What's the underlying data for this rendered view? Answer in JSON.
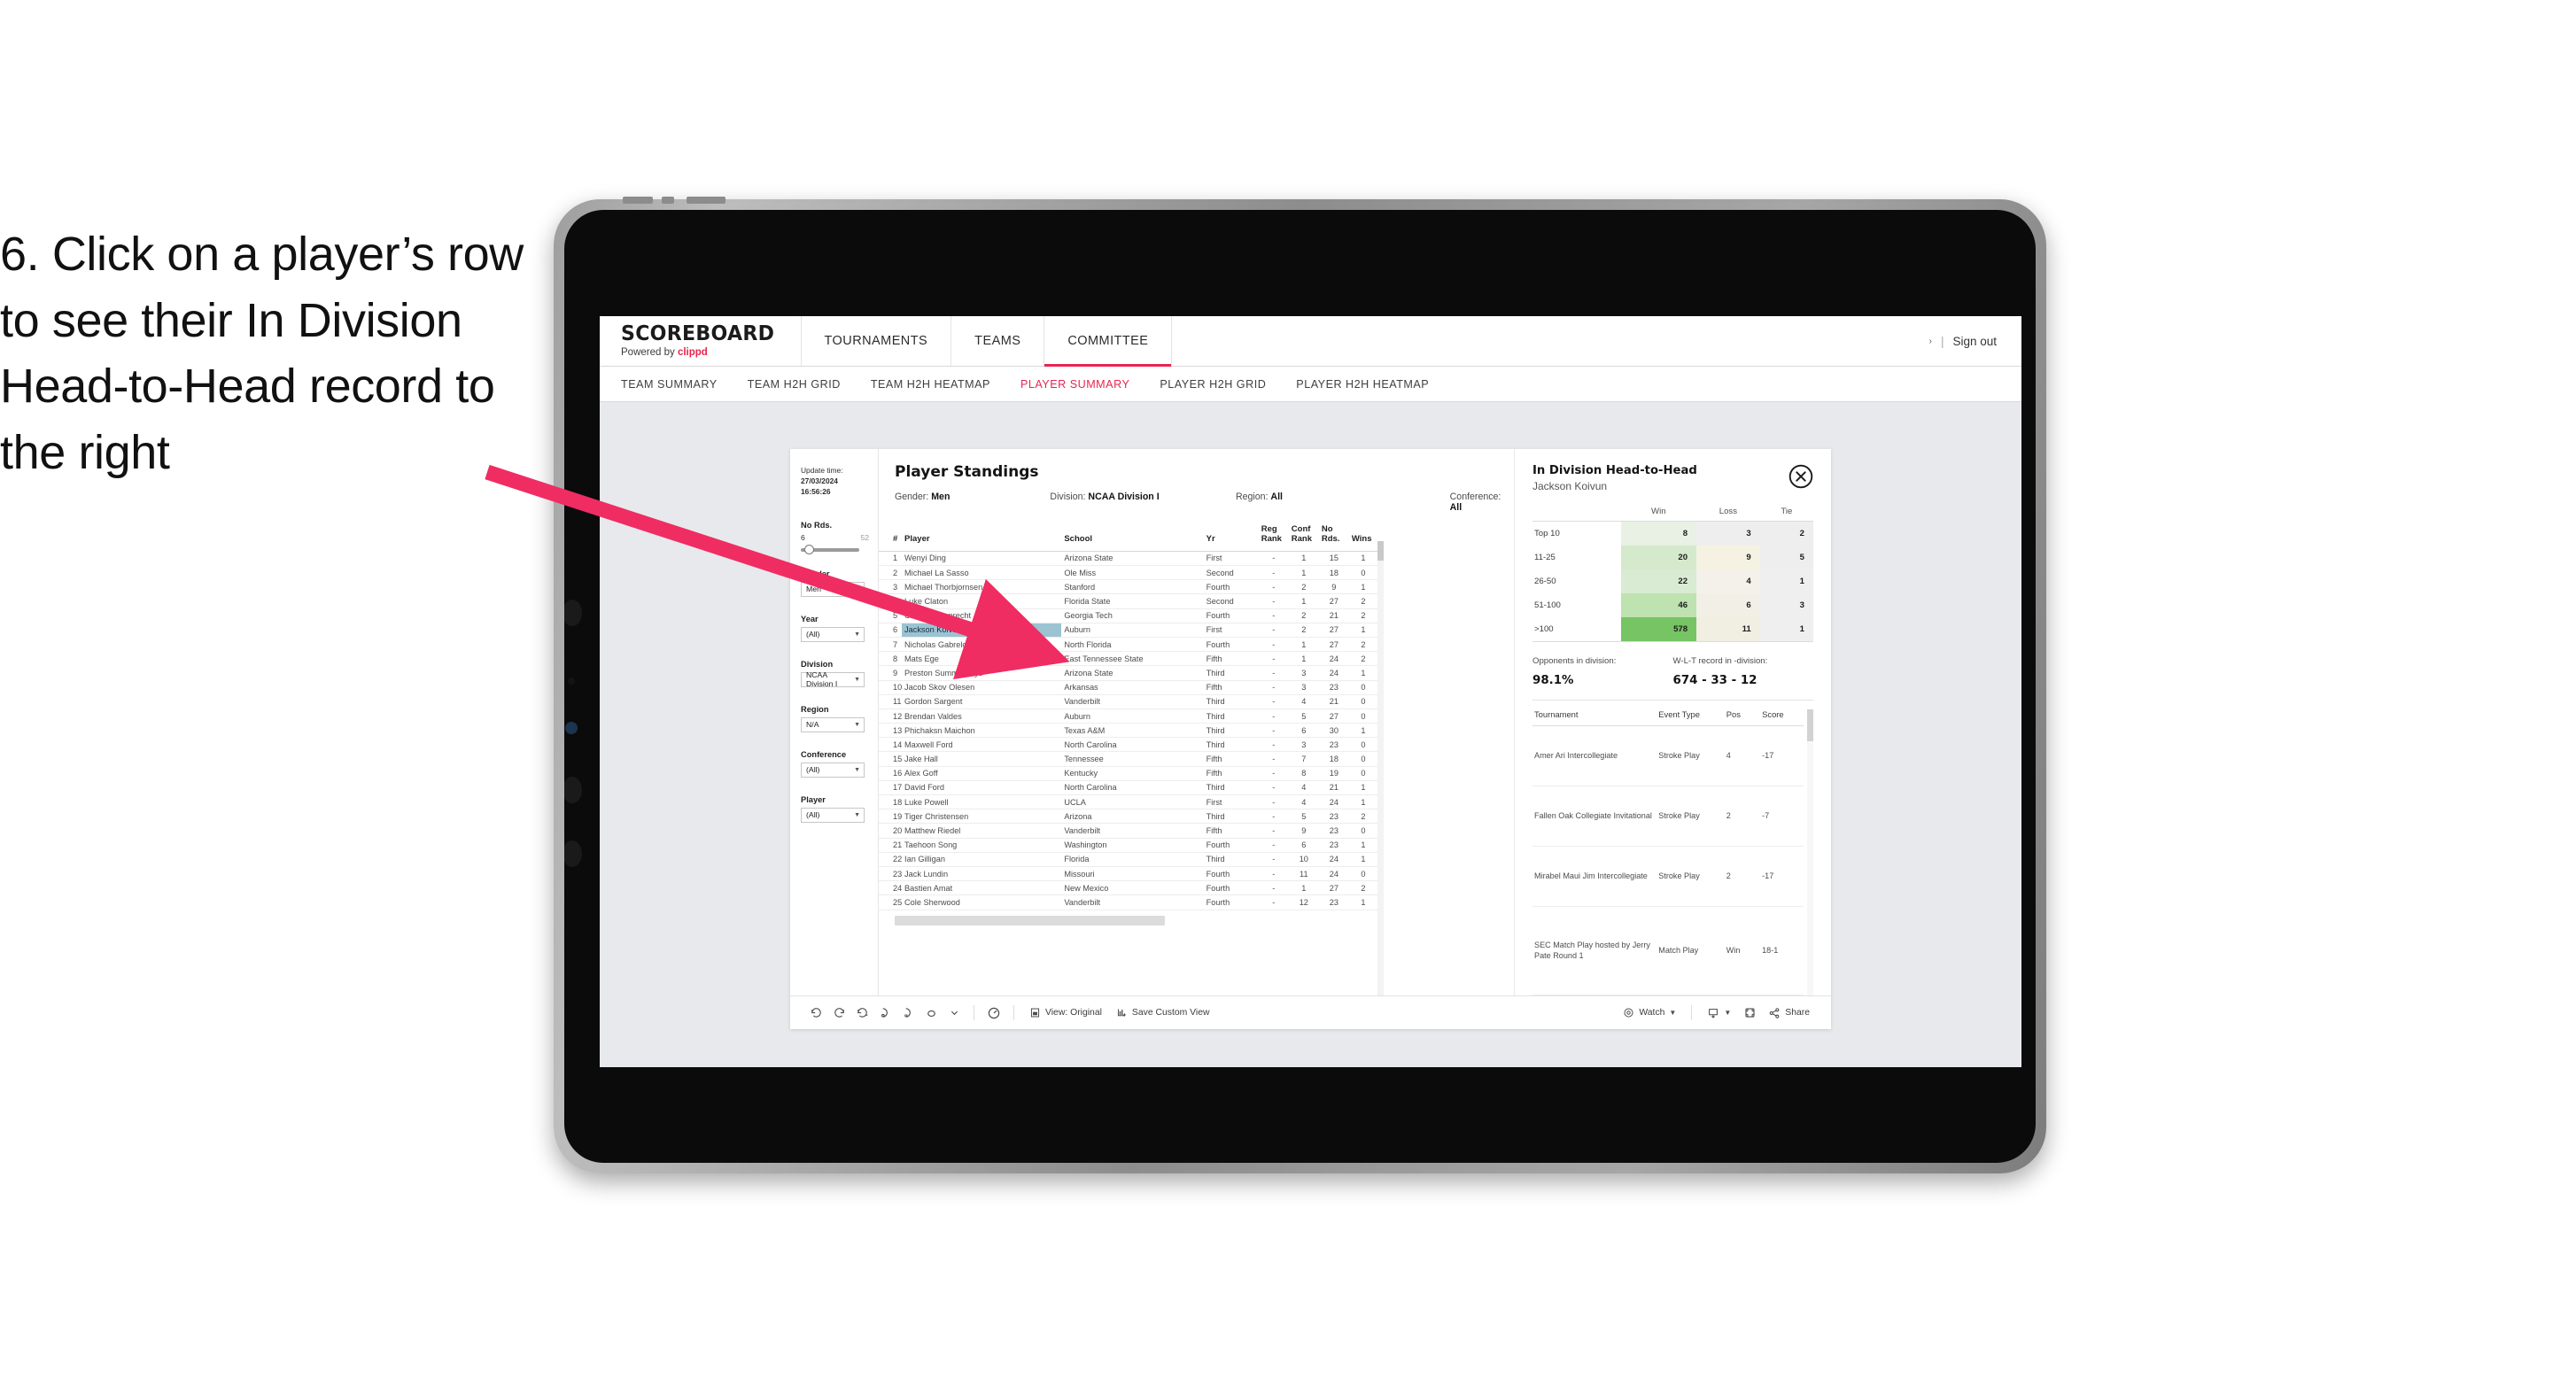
{
  "instruction": {
    "text": "6. Click on a player’s row to see their In Division Head-to-Head record to the right"
  },
  "header": {
    "brand_name": "SCOREBOARD",
    "brand_sub_prefix": "Powered by ",
    "brand_sub_accent": "clippd",
    "nav": [
      {
        "label": "TOURNAMENTS",
        "active": false
      },
      {
        "label": "TEAMS",
        "active": false
      },
      {
        "label": "COMMITTEE",
        "active": true
      }
    ],
    "sign_out": "Sign out",
    "separator": "|"
  },
  "subnav": [
    {
      "label": "TEAM SUMMARY",
      "active": false
    },
    {
      "label": "TEAM H2H GRID",
      "active": false
    },
    {
      "label": "TEAM H2H HEATMAP",
      "active": false
    },
    {
      "label": "PLAYER SUMMARY",
      "active": true
    },
    {
      "label": "PLAYER H2H GRID",
      "active": false
    },
    {
      "label": "PLAYER H2H HEATMAP",
      "active": false
    }
  ],
  "rail": {
    "update_label": "Update time:",
    "update_value": "27/03/2024 16:56:26",
    "slider": {
      "title": "No Rds.",
      "min": "6",
      "max": "52"
    },
    "filters": [
      {
        "title": "Gender",
        "value": "Men"
      },
      {
        "title": "Year",
        "value": "(All)"
      },
      {
        "title": "Division",
        "value": "NCAA Division I"
      },
      {
        "title": "Region",
        "value": "N/A"
      },
      {
        "title": "Conference",
        "value": "(All)"
      },
      {
        "title": "Player",
        "value": "(All)"
      }
    ]
  },
  "standings": {
    "title": "Player Standings",
    "filter_summary": [
      {
        "label": "Gender:",
        "value": "Men"
      },
      {
        "label": "Division:",
        "value": "NCAA Division I"
      },
      {
        "label": "Region:",
        "value": "All"
      },
      {
        "label": "Conference:",
        "value": "All"
      }
    ],
    "columns": [
      "#",
      "Player",
      "School",
      "Yr",
      "Reg Rank",
      "Conf Rank",
      "No Rds.",
      "Wins"
    ],
    "columns_split": [
      {
        "l1": "#",
        "l2": ""
      },
      {
        "l1": "Player",
        "l2": ""
      },
      {
        "l1": "School",
        "l2": ""
      },
      {
        "l1": "Yr",
        "l2": ""
      },
      {
        "l1": "Reg",
        "l2": "Rank"
      },
      {
        "l1": "Conf",
        "l2": "Rank"
      },
      {
        "l1": "No",
        "l2": "Rds."
      },
      {
        "l1": "Wins",
        "l2": ""
      }
    ],
    "rows": [
      {
        "rank": "1",
        "player": "Wenyi Ding",
        "school": "Arizona State",
        "yr": "First",
        "reg": "-",
        "conf": "1",
        "rds": "15",
        "wins": "1",
        "selected": false
      },
      {
        "rank": "2",
        "player": "Michael La Sasso",
        "school": "Ole Miss",
        "yr": "Second",
        "reg": "-",
        "conf": "1",
        "rds": "18",
        "wins": "0",
        "selected": false
      },
      {
        "rank": "3",
        "player": "Michael Thorbjornsen",
        "school": "Stanford",
        "yr": "Fourth",
        "reg": "-",
        "conf": "2",
        "rds": "9",
        "wins": "1",
        "selected": false
      },
      {
        "rank": "4",
        "player": "Luke Claton",
        "school": "Florida State",
        "yr": "Second",
        "reg": "-",
        "conf": "1",
        "rds": "27",
        "wins": "2",
        "selected": false
      },
      {
        "rank": "5",
        "player": "Christo Lamprecht",
        "school": "Georgia Tech",
        "yr": "Fourth",
        "reg": "-",
        "conf": "2",
        "rds": "21",
        "wins": "2",
        "selected": false
      },
      {
        "rank": "6",
        "player": "Jackson Koivun",
        "school": "Auburn",
        "yr": "First",
        "reg": "-",
        "conf": "2",
        "rds": "27",
        "wins": "1",
        "selected": true
      },
      {
        "rank": "7",
        "player": "Nicholas Gabrelcik",
        "school": "North Florida",
        "yr": "Fourth",
        "reg": "-",
        "conf": "1",
        "rds": "27",
        "wins": "2",
        "selected": false
      },
      {
        "rank": "8",
        "player": "Mats Ege",
        "school": "East Tennessee State",
        "yr": "Fifth",
        "reg": "-",
        "conf": "1",
        "rds": "24",
        "wins": "2",
        "selected": false
      },
      {
        "rank": "9",
        "player": "Preston Summerhays",
        "school": "Arizona State",
        "yr": "Third",
        "reg": "-",
        "conf": "3",
        "rds": "24",
        "wins": "1",
        "selected": false
      },
      {
        "rank": "10",
        "player": "Jacob Skov Olesen",
        "school": "Arkansas",
        "yr": "Fifth",
        "reg": "-",
        "conf": "3",
        "rds": "23",
        "wins": "0",
        "selected": false
      },
      {
        "rank": "11",
        "player": "Gordon Sargent",
        "school": "Vanderbilt",
        "yr": "Third",
        "reg": "-",
        "conf": "4",
        "rds": "21",
        "wins": "0",
        "selected": false
      },
      {
        "rank": "12",
        "player": "Brendan Valdes",
        "school": "Auburn",
        "yr": "Third",
        "reg": "-",
        "conf": "5",
        "rds": "27",
        "wins": "0",
        "selected": false
      },
      {
        "rank": "13",
        "player": "Phichaksn Maichon",
        "school": "Texas A&M",
        "yr": "Third",
        "reg": "-",
        "conf": "6",
        "rds": "30",
        "wins": "1",
        "selected": false
      },
      {
        "rank": "14",
        "player": "Maxwell Ford",
        "school": "North Carolina",
        "yr": "Third",
        "reg": "-",
        "conf": "3",
        "rds": "23",
        "wins": "0",
        "selected": false
      },
      {
        "rank": "15",
        "player": "Jake Hall",
        "school": "Tennessee",
        "yr": "Fifth",
        "reg": "-",
        "conf": "7",
        "rds": "18",
        "wins": "0",
        "selected": false
      },
      {
        "rank": "16",
        "player": "Alex Goff",
        "school": "Kentucky",
        "yr": "Fifth",
        "reg": "-",
        "conf": "8",
        "rds": "19",
        "wins": "0",
        "selected": false
      },
      {
        "rank": "17",
        "player": "David Ford",
        "school": "North Carolina",
        "yr": "Third",
        "reg": "-",
        "conf": "4",
        "rds": "21",
        "wins": "1",
        "selected": false
      },
      {
        "rank": "18",
        "player": "Luke Powell",
        "school": "UCLA",
        "yr": "First",
        "reg": "-",
        "conf": "4",
        "rds": "24",
        "wins": "1",
        "selected": false
      },
      {
        "rank": "19",
        "player": "Tiger Christensen",
        "school": "Arizona",
        "yr": "Third",
        "reg": "-",
        "conf": "5",
        "rds": "23",
        "wins": "2",
        "selected": false
      },
      {
        "rank": "20",
        "player": "Matthew Riedel",
        "school": "Vanderbilt",
        "yr": "Fifth",
        "reg": "-",
        "conf": "9",
        "rds": "23",
        "wins": "0",
        "selected": false
      },
      {
        "rank": "21",
        "player": "Taehoon Song",
        "school": "Washington",
        "yr": "Fourth",
        "reg": "-",
        "conf": "6",
        "rds": "23",
        "wins": "1",
        "selected": false
      },
      {
        "rank": "22",
        "player": "Ian Gilligan",
        "school": "Florida",
        "yr": "Third",
        "reg": "-",
        "conf": "10",
        "rds": "24",
        "wins": "1",
        "selected": false
      },
      {
        "rank": "23",
        "player": "Jack Lundin",
        "school": "Missouri",
        "yr": "Fourth",
        "reg": "-",
        "conf": "11",
        "rds": "24",
        "wins": "0",
        "selected": false
      },
      {
        "rank": "24",
        "player": "Bastien Amat",
        "school": "New Mexico",
        "yr": "Fourth",
        "reg": "-",
        "conf": "1",
        "rds": "27",
        "wins": "2",
        "selected": false
      },
      {
        "rank": "25",
        "player": "Cole Sherwood",
        "school": "Vanderbilt",
        "yr": "Fourth",
        "reg": "-",
        "conf": "12",
        "rds": "23",
        "wins": "1",
        "selected": false
      }
    ]
  },
  "detail": {
    "title": "In Division Head-to-Head",
    "subtitle": "Jackson Koivun",
    "close_icon": "close-circle-icon",
    "chart_data": {
      "type": "heatmap",
      "title": "In Division Head-to-Head",
      "subtitle": "Jackson Koivun",
      "columns": [
        "Win",
        "Loss",
        "Tie"
      ],
      "rows": [
        "Top 10",
        "11-25",
        "26-50",
        "51-100",
        ">100"
      ],
      "values": [
        [
          8,
          3,
          2
        ],
        [
          20,
          9,
          5
        ],
        [
          22,
          4,
          1
        ],
        [
          46,
          6,
          3
        ],
        [
          578,
          11,
          1
        ]
      ],
      "cell_colors": [
        [
          "#e8f1e4",
          "#eeeeee",
          "#eeeeee"
        ],
        [
          "#d5e9cd",
          "#f5f2e3",
          "#eeeeee"
        ],
        [
          "#d9ebd2",
          "#f3f1ea",
          "#efefef"
        ],
        [
          "#bee2b0",
          "#f2f0e6",
          "#efefef"
        ],
        [
          "#76c464",
          "#f1eee2",
          "#efefef"
        ]
      ],
      "accent": "#76c464"
    },
    "summary": [
      {
        "label": "Opponents in division:",
        "value": "98.1%"
      },
      {
        "label": "W-L-T record in -division:",
        "value": "674 - 33 - 12"
      }
    ],
    "tournaments": {
      "columns": [
        "Tournament",
        "Event Type",
        "Pos",
        "Score"
      ],
      "rows": [
        {
          "name": "Amer Ari Intercollegiate",
          "type": "Stroke Play",
          "pos": "4",
          "score": "-17"
        },
        {
          "name": "Fallen Oak Collegiate Invitational",
          "type": "Stroke Play",
          "pos": "2",
          "score": "-7"
        },
        {
          "name": "Mirabel Maui Jim Intercollegiate",
          "type": "Stroke Play",
          "pos": "2",
          "score": "-17"
        },
        {
          "name": "SEC Match Play hosted by Jerry Pate Round 1",
          "type": "Match Play",
          "pos": "Win",
          "score": "18-1"
        }
      ]
    }
  },
  "toolbar": {
    "icons": [
      "undo-icon",
      "redo-icon",
      "revert-icon",
      "refresh-icon",
      "pause-icon",
      "alerts-icon",
      "dropdown-icon",
      "highlight-icon"
    ],
    "view_label": "View: Original",
    "save_label": "Save Custom View",
    "watch_label": "Watch",
    "share_label": "Share",
    "download_icon": "download-icon",
    "fullscreen_icon": "fullscreen-icon"
  },
  "colors": {
    "accent_pink": "#e8254f",
    "selected_row": "#9bc3d2",
    "heatmap_green": "#76c464",
    "arrow": "#ef2d62"
  }
}
